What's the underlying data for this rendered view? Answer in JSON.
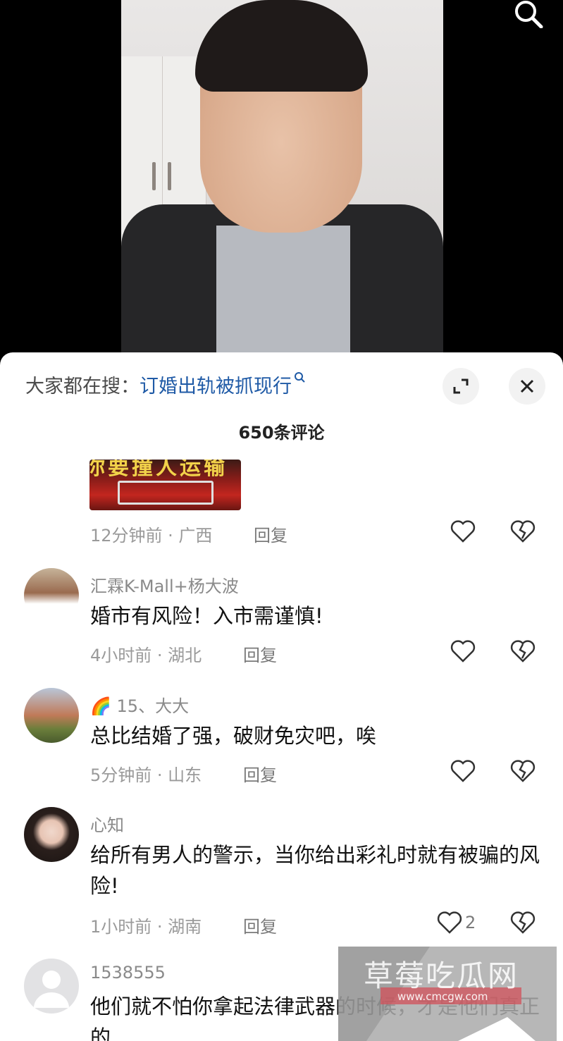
{
  "top_bar": {
    "search_icon": "search-icon"
  },
  "panel": {
    "trending_prefix": "大家都在搜：",
    "trending_query": "订婚出轨被抓现行",
    "expand_icon": "expand-icon",
    "close_icon": "close-icon",
    "comment_count": "650条评论"
  },
  "first_comment": {
    "thumb_text": "你要撞人运输",
    "meta": "12分钟前 · 广西",
    "reply": "回复"
  },
  "comments": [
    {
      "username": "汇霖K-Mall+杨大波",
      "text": "婚市有风险！入市需谨慎!",
      "meta": "4小时前 · 湖北",
      "reply": "回复"
    },
    {
      "badge": "🌈",
      "username": "15、大大",
      "text": "总比结婚了强，破财免灾吧，唉",
      "meta": "5分钟前 · 山东",
      "reply": "回复"
    },
    {
      "username": "心知",
      "text": "给所有男人的警示，当你给出彩礼时就有被骗的风险!",
      "meta": "1小时前 · 湖南",
      "reply": "回复",
      "likes": "2"
    },
    {
      "username": "1538555",
      "text": "他们就不怕你拿起法律武器的时候，才是他们真正的"
    }
  ],
  "watermark": {
    "title": "草莓吃瓜网",
    "url": "www.cmcgw.com"
  },
  "colors": {
    "link": "#1f5aa6",
    "muted": "#9a9a9a",
    "text": "#111111"
  }
}
